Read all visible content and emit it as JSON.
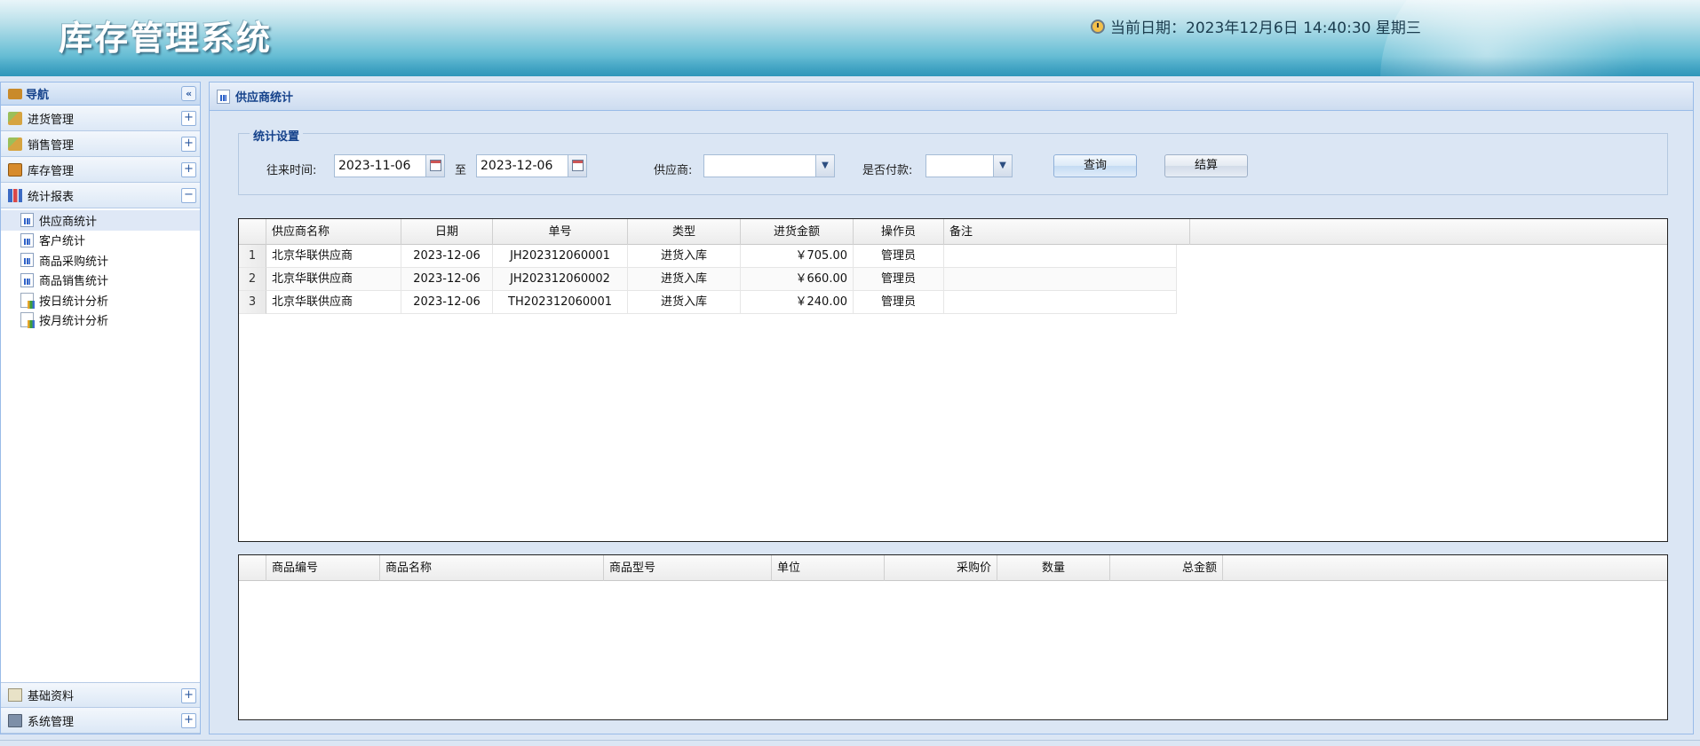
{
  "app": {
    "title": "库存管理系统",
    "clock_text": "当前日期：2023年12月6日 14:40:30 星期三"
  },
  "nav": {
    "title": "导航",
    "collapse_symbol": "«",
    "sections": [
      {
        "label": "进货管理",
        "icon": "truck-icon",
        "toggle": "+"
      },
      {
        "label": "销售管理",
        "icon": "truck-icon",
        "toggle": "+"
      },
      {
        "label": "库存管理",
        "icon": "box-icon",
        "toggle": "+"
      },
      {
        "label": "统计报表",
        "icon": "bar-chart-icon",
        "toggle": "−"
      }
    ],
    "report_items": [
      {
        "label": "供应商统计",
        "icon": "report-icon",
        "active": true
      },
      {
        "label": "客户统计",
        "icon": "report-icon"
      },
      {
        "label": "商品采购统计",
        "icon": "report-icon"
      },
      {
        "label": "商品销售统计",
        "icon": "report-icon"
      },
      {
        "label": "按日统计分析",
        "icon": "chart-doc-icon"
      },
      {
        "label": "按月统计分析",
        "icon": "chart-doc-icon"
      }
    ],
    "bottom_sections": [
      {
        "label": "基础资料",
        "icon": "folder-icon",
        "toggle": "+"
      },
      {
        "label": "系统管理",
        "icon": "monitor-icon",
        "toggle": "+"
      }
    ]
  },
  "main": {
    "title": "供应商统计",
    "form": {
      "legend": "统计设置",
      "date_label": "往来时间:",
      "date_from": "2023-11-06",
      "to_label": "至",
      "date_to": "2023-12-06",
      "supplier_label": "供应商:",
      "supplier_value": "",
      "paid_label": "是否付款:",
      "paid_value": "",
      "query_button": "查询",
      "settle_button": "结算"
    },
    "top_grid": {
      "columns": [
        "供应商名称",
        "日期",
        "单号",
        "类型",
        "进货金额",
        "操作员",
        "备注"
      ],
      "rows": [
        {
          "num": "1",
          "supplier": "北京华联供应商",
          "date": "2023-12-06",
          "order": "JH202312060001",
          "type": "进货入库",
          "amount": "￥705.00",
          "operator": "管理员",
          "remark": ""
        },
        {
          "num": "2",
          "supplier": "北京华联供应商",
          "date": "2023-12-06",
          "order": "JH202312060002",
          "type": "进货入库",
          "amount": "￥660.00",
          "operator": "管理员",
          "remark": ""
        },
        {
          "num": "3",
          "supplier": "北京华联供应商",
          "date": "2023-12-06",
          "order": "TH202312060001",
          "type": "进货入库",
          "amount": "￥240.00",
          "operator": "管理员",
          "remark": ""
        }
      ]
    },
    "bottom_grid": {
      "columns": [
        "商品编号",
        "商品名称",
        "商品型号",
        "单位",
        "采购价",
        "数量",
        "总金额"
      ]
    }
  }
}
